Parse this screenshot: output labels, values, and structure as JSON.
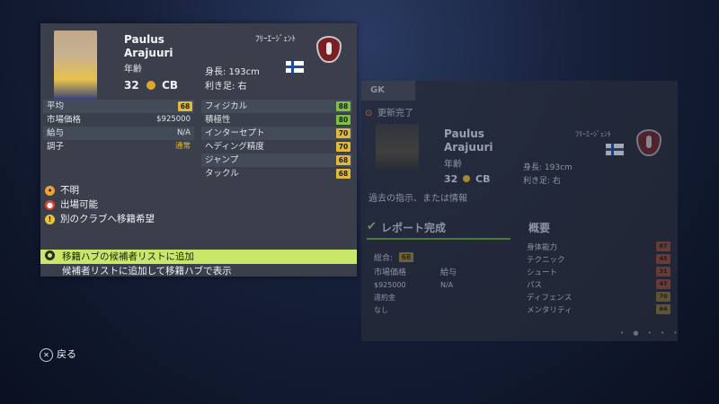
{
  "player": {
    "first_name": "Paulus",
    "last_name": "Arajuuri",
    "age_label": "年齢",
    "age": "32",
    "position": "CB",
    "height": "身長: 193cm",
    "foot": "利き足: 右",
    "club": "ﾌﾘｰｴｰｼﾞｪﾝﾄ"
  },
  "info": [
    {
      "label": "平均",
      "value": "68",
      "color": "#e0b83a"
    },
    {
      "label": "市場価格",
      "value": "$925000"
    },
    {
      "label": "給与",
      "value": "N/A"
    },
    {
      "label": "調子",
      "value": "通常",
      "value_color": "#e0b83a"
    }
  ],
  "attributes": [
    {
      "label": "フィジカル",
      "value": "88",
      "color": "#7bc043"
    },
    {
      "label": "積極性",
      "value": "80",
      "color": "#7bc043"
    },
    {
      "label": "インターセプト",
      "value": "70",
      "color": "#e0b83a"
    },
    {
      "label": "ヘディング精度",
      "value": "70",
      "color": "#e0b83a"
    },
    {
      "label": "ジャンプ",
      "value": "68",
      "color": "#e0b83a"
    },
    {
      "label": "タックル",
      "value": "68",
      "color": "#e0b83a"
    }
  ],
  "statuses": [
    {
      "icon": "unknown-face-icon",
      "glyph": "•",
      "color": "#e8a33a",
      "label": "不明"
    },
    {
      "icon": "available-icon",
      "glyph": "●",
      "color": "#d8453a",
      "label": "出場可能"
    },
    {
      "icon": "warning-icon",
      "glyph": "!",
      "color": "#e8c43a",
      "label": "別のクラブへ移籍希望"
    }
  ],
  "actions": {
    "primary": "移籍ハブの候補者リストに追加",
    "secondary": "候補者リストに追加して移籍ハブで表示"
  },
  "footer": {
    "back_glyph": "✕",
    "back_label": "戻る"
  },
  "background_panel": {
    "tab": "GK",
    "update_status": "更新完了",
    "first_name": "Paulus",
    "last_name": "Arajuuri",
    "age_label": "年齢",
    "age": "32",
    "position": "CB",
    "height": "身長: 193cm",
    "foot": "利き足: 右",
    "club": "ﾌﾘｰｴｰｼﾞｪﾝﾄ",
    "note": "過去の指示、または情報",
    "report_title": "レポート完成",
    "overall_label": "総合:",
    "overall_value": "68",
    "market_label": "市場価格",
    "salary_label": "給与",
    "market_value": "$925000",
    "salary_value": "N/A",
    "contract_label": "違約金",
    "contract_value": "なし",
    "summary_title": "概要",
    "summary": [
      {
        "label": "身体能力",
        "value": "87"
      },
      {
        "label": "テクニック",
        "value": "45"
      },
      {
        "label": "シュート",
        "value": "31"
      },
      {
        "label": "パス",
        "value": "47"
      },
      {
        "label": "ディフェンス",
        "value": "70"
      },
      {
        "label": "メンタリティ",
        "value": "64"
      }
    ]
  }
}
